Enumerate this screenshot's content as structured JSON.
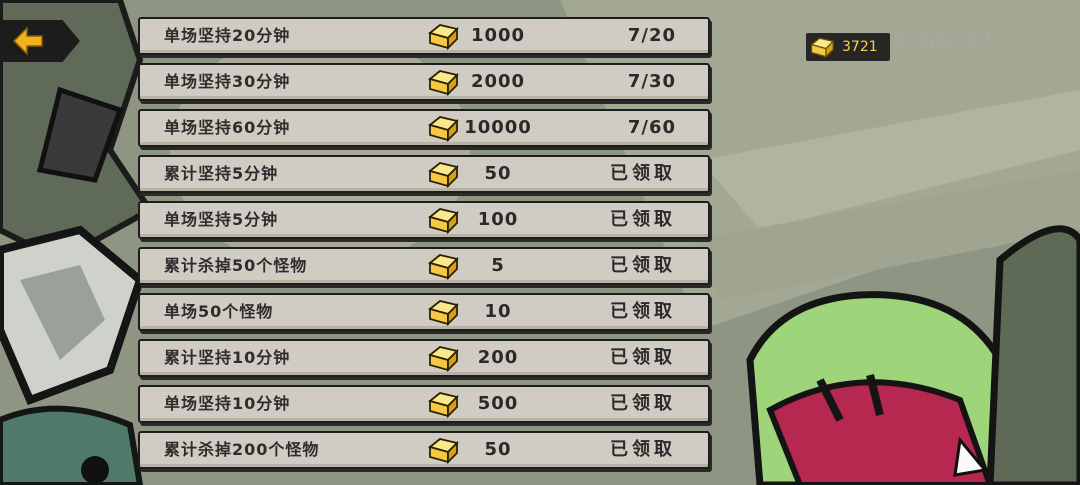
{
  "hud": {
    "fps_text": "FPS:60.37",
    "currency_icon": "gold-bar-icon",
    "currency_amount": "3721",
    "back_icon": "back-arrow-icon"
  },
  "colors": {
    "gold": "#f5c843",
    "row_background": "#d0cbc3",
    "back_arrow": "#f3b21c"
  },
  "tasks": [
    {
      "title": "单场坚持20分钟",
      "reward": "1000",
      "status": "7/20"
    },
    {
      "title": "单场坚持30分钟",
      "reward": "2000",
      "status": "7/30"
    },
    {
      "title": "单场坚持60分钟",
      "reward": "10000",
      "status": "7/60"
    },
    {
      "title": "累计坚持5分钟",
      "reward": "50",
      "status": "已领取"
    },
    {
      "title": "单场坚持5分钟",
      "reward": "100",
      "status": "已领取"
    },
    {
      "title": "累计杀掉50个怪物",
      "reward": "5",
      "status": "已领取"
    },
    {
      "title": "单场50个怪物",
      "reward": "10",
      "status": "已领取"
    },
    {
      "title": "累计坚持10分钟",
      "reward": "200",
      "status": "已领取"
    },
    {
      "title": "单场坚持10分钟",
      "reward": "500",
      "status": "已领取"
    },
    {
      "title": "累计杀掉200个怪物",
      "reward": "50",
      "status": "已领取"
    }
  ]
}
